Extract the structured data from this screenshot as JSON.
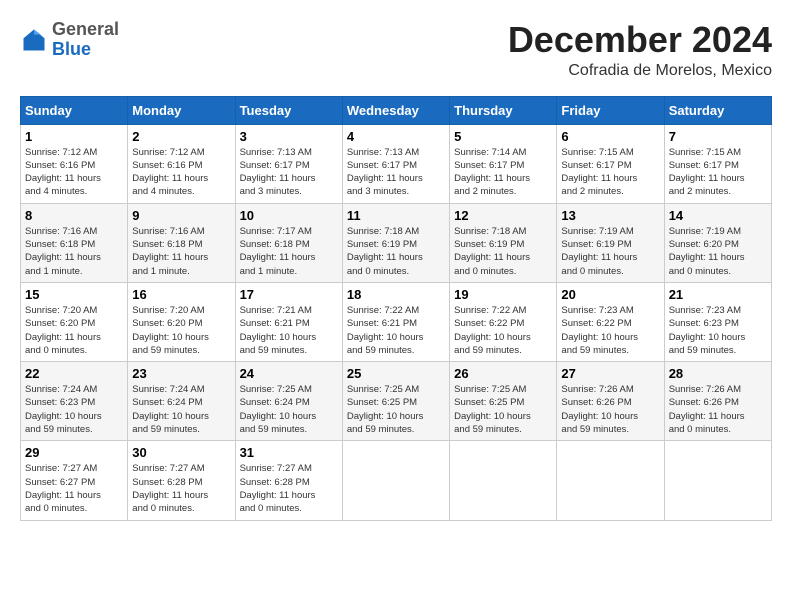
{
  "header": {
    "logo_general": "General",
    "logo_blue": "Blue",
    "month_title": "December 2024",
    "location": "Cofradia de Morelos, Mexico"
  },
  "days_of_week": [
    "Sunday",
    "Monday",
    "Tuesday",
    "Wednesday",
    "Thursday",
    "Friday",
    "Saturday"
  ],
  "weeks": [
    [
      {
        "num": "1",
        "info": "Sunrise: 7:12 AM\nSunset: 6:16 PM\nDaylight: 11 hours\nand 4 minutes."
      },
      {
        "num": "2",
        "info": "Sunrise: 7:12 AM\nSunset: 6:16 PM\nDaylight: 11 hours\nand 4 minutes."
      },
      {
        "num": "3",
        "info": "Sunrise: 7:13 AM\nSunset: 6:17 PM\nDaylight: 11 hours\nand 3 minutes."
      },
      {
        "num": "4",
        "info": "Sunrise: 7:13 AM\nSunset: 6:17 PM\nDaylight: 11 hours\nand 3 minutes."
      },
      {
        "num": "5",
        "info": "Sunrise: 7:14 AM\nSunset: 6:17 PM\nDaylight: 11 hours\nand 2 minutes."
      },
      {
        "num": "6",
        "info": "Sunrise: 7:15 AM\nSunset: 6:17 PM\nDaylight: 11 hours\nand 2 minutes."
      },
      {
        "num": "7",
        "info": "Sunrise: 7:15 AM\nSunset: 6:17 PM\nDaylight: 11 hours\nand 2 minutes."
      }
    ],
    [
      {
        "num": "8",
        "info": "Sunrise: 7:16 AM\nSunset: 6:18 PM\nDaylight: 11 hours\nand 1 minute."
      },
      {
        "num": "9",
        "info": "Sunrise: 7:16 AM\nSunset: 6:18 PM\nDaylight: 11 hours\nand 1 minute."
      },
      {
        "num": "10",
        "info": "Sunrise: 7:17 AM\nSunset: 6:18 PM\nDaylight: 11 hours\nand 1 minute."
      },
      {
        "num": "11",
        "info": "Sunrise: 7:18 AM\nSunset: 6:19 PM\nDaylight: 11 hours\nand 0 minutes."
      },
      {
        "num": "12",
        "info": "Sunrise: 7:18 AM\nSunset: 6:19 PM\nDaylight: 11 hours\nand 0 minutes."
      },
      {
        "num": "13",
        "info": "Sunrise: 7:19 AM\nSunset: 6:19 PM\nDaylight: 11 hours\nand 0 minutes."
      },
      {
        "num": "14",
        "info": "Sunrise: 7:19 AM\nSunset: 6:20 PM\nDaylight: 11 hours\nand 0 minutes."
      }
    ],
    [
      {
        "num": "15",
        "info": "Sunrise: 7:20 AM\nSunset: 6:20 PM\nDaylight: 11 hours\nand 0 minutes."
      },
      {
        "num": "16",
        "info": "Sunrise: 7:20 AM\nSunset: 6:20 PM\nDaylight: 10 hours\nand 59 minutes."
      },
      {
        "num": "17",
        "info": "Sunrise: 7:21 AM\nSunset: 6:21 PM\nDaylight: 10 hours\nand 59 minutes."
      },
      {
        "num": "18",
        "info": "Sunrise: 7:22 AM\nSunset: 6:21 PM\nDaylight: 10 hours\nand 59 minutes."
      },
      {
        "num": "19",
        "info": "Sunrise: 7:22 AM\nSunset: 6:22 PM\nDaylight: 10 hours\nand 59 minutes."
      },
      {
        "num": "20",
        "info": "Sunrise: 7:23 AM\nSunset: 6:22 PM\nDaylight: 10 hours\nand 59 minutes."
      },
      {
        "num": "21",
        "info": "Sunrise: 7:23 AM\nSunset: 6:23 PM\nDaylight: 10 hours\nand 59 minutes."
      }
    ],
    [
      {
        "num": "22",
        "info": "Sunrise: 7:24 AM\nSunset: 6:23 PM\nDaylight: 10 hours\nand 59 minutes."
      },
      {
        "num": "23",
        "info": "Sunrise: 7:24 AM\nSunset: 6:24 PM\nDaylight: 10 hours\nand 59 minutes."
      },
      {
        "num": "24",
        "info": "Sunrise: 7:25 AM\nSunset: 6:24 PM\nDaylight: 10 hours\nand 59 minutes."
      },
      {
        "num": "25",
        "info": "Sunrise: 7:25 AM\nSunset: 6:25 PM\nDaylight: 10 hours\nand 59 minutes."
      },
      {
        "num": "26",
        "info": "Sunrise: 7:25 AM\nSunset: 6:25 PM\nDaylight: 10 hours\nand 59 minutes."
      },
      {
        "num": "27",
        "info": "Sunrise: 7:26 AM\nSunset: 6:26 PM\nDaylight: 10 hours\nand 59 minutes."
      },
      {
        "num": "28",
        "info": "Sunrise: 7:26 AM\nSunset: 6:26 PM\nDaylight: 11 hours\nand 0 minutes."
      }
    ],
    [
      {
        "num": "29",
        "info": "Sunrise: 7:27 AM\nSunset: 6:27 PM\nDaylight: 11 hours\nand 0 minutes."
      },
      {
        "num": "30",
        "info": "Sunrise: 7:27 AM\nSunset: 6:28 PM\nDaylight: 11 hours\nand 0 minutes."
      },
      {
        "num": "31",
        "info": "Sunrise: 7:27 AM\nSunset: 6:28 PM\nDaylight: 11 hours\nand 0 minutes."
      },
      null,
      null,
      null,
      null
    ]
  ]
}
